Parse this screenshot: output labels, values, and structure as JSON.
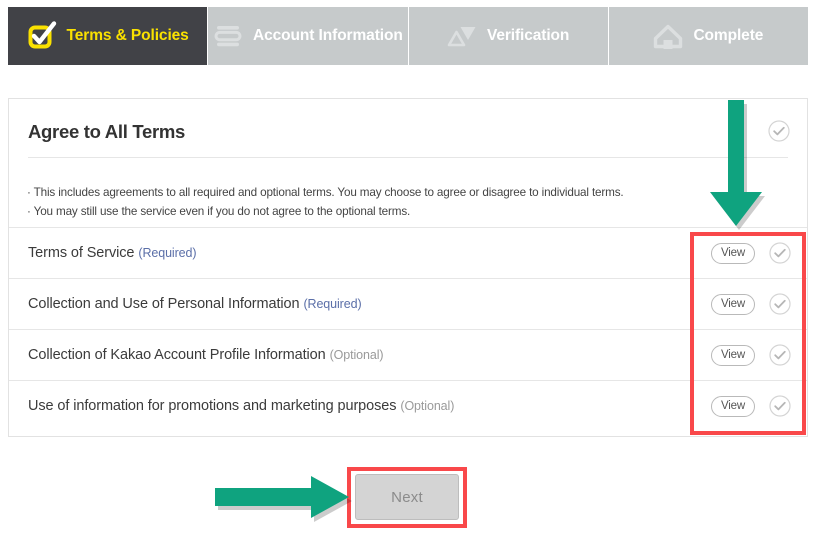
{
  "wizard": {
    "steps": [
      {
        "label": "Terms & Policies",
        "icon": "checkbox-checked-icon",
        "state": "active"
      },
      {
        "label": "Account Information",
        "icon": "id-card-icon",
        "state": "inactive"
      },
      {
        "label": "Verification",
        "icon": "triangles-icon",
        "state": "inactive"
      },
      {
        "label": "Complete",
        "icon": "home-icon",
        "state": "inactive"
      }
    ],
    "active_color": "#fae100",
    "active_bg": "#414247",
    "inactive_bg": "#c6cacb"
  },
  "agree": {
    "title": "Agree to All Terms",
    "notes": [
      "· This includes agreements to all required and optional terms. You may choose to agree or disagree to individual terms.",
      "· You may still use the service even if you do not agree to the optional terms."
    ]
  },
  "terms": [
    {
      "label": "Terms of Service",
      "tag": "(Required)",
      "tag_kind": "required",
      "view_label": "View",
      "checked": true
    },
    {
      "label": "Collection and Use of Personal Information",
      "tag": "(Required)",
      "tag_kind": "required",
      "view_label": "View",
      "checked": true
    },
    {
      "label": "Collection of Kakao Account Profile Information",
      "tag": "(Optional)",
      "tag_kind": "optional",
      "view_label": "View",
      "checked": true
    },
    {
      "label": "Use of information for promotions and marketing purposes",
      "tag": "(Optional)",
      "tag_kind": "optional",
      "view_label": "View",
      "checked": true
    }
  ],
  "footer": {
    "next_label": "Next"
  },
  "annotations": {
    "arrow_color": "#0fa37f",
    "highlight_color": "#f9484a",
    "arrow_down_target": "view-and-check-column",
    "arrow_right_target": "next-button",
    "highlight_rows_target": "view-and-check-column",
    "highlight_next_target": "next-button"
  }
}
